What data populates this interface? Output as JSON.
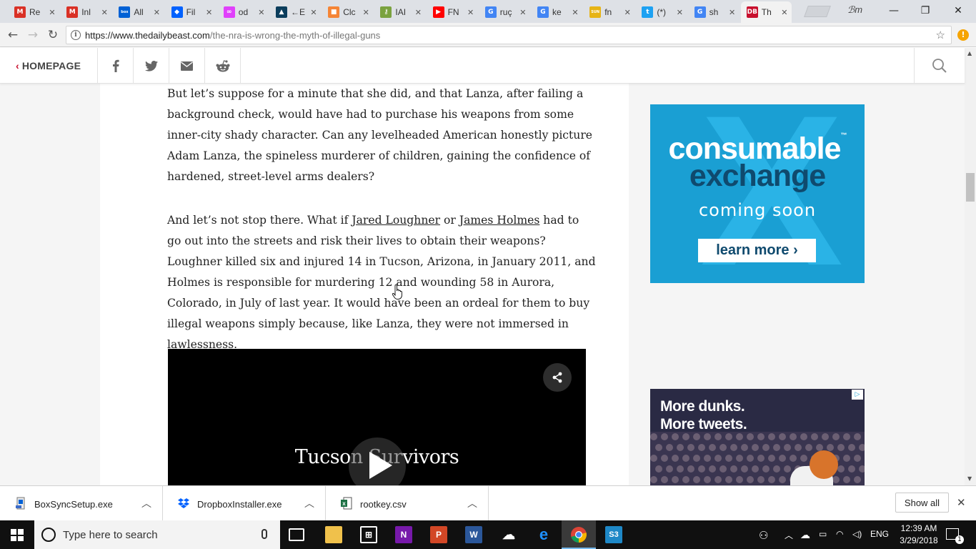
{
  "browser": {
    "tabs": [
      {
        "title": "Re",
        "icon": "gmail-icon",
        "color": "#d93025",
        "glyph": "M"
      },
      {
        "title": "Inl",
        "icon": "gmail-icon",
        "color": "#d93025",
        "glyph": "M"
      },
      {
        "title": "All",
        "icon": "box-icon",
        "color": "#0061d5",
        "glyph": "box"
      },
      {
        "title": "Fil",
        "icon": "dropbox-icon",
        "color": "#0061fe",
        "glyph": "◆"
      },
      {
        "title": "od",
        "icon": "infinity-icon",
        "color": "#e040fb",
        "glyph": "∞"
      },
      {
        "title": "←E",
        "icon": "app-icon",
        "color": "#0b3d5c",
        "glyph": "▲"
      },
      {
        "title": "Clc",
        "icon": "aws-cube-icon",
        "color": "#f58536",
        "glyph": "■"
      },
      {
        "title": "IAI",
        "icon": "key-icon",
        "color": "#7aa23f",
        "glyph": "⚷"
      },
      {
        "title": "FN",
        "icon": "youtube-icon",
        "color": "#ff0000",
        "glyph": "▶"
      },
      {
        "title": "ruç",
        "icon": "google-icon",
        "color": "#4285f4",
        "glyph": "G"
      },
      {
        "title": "ke",
        "icon": "google-icon",
        "color": "#4285f4",
        "glyph": "G"
      },
      {
        "title": "fn",
        "icon": "sun-icon",
        "color": "#e7b416",
        "glyph": "SUN"
      },
      {
        "title": "(*)",
        "icon": "twitter-icon",
        "color": "#1da1f2",
        "glyph": "t"
      },
      {
        "title": "sh",
        "icon": "google-icon",
        "color": "#4285f4",
        "glyph": "G"
      },
      {
        "title": "Th",
        "icon": "daily-beast-icon",
        "color": "#c8102e",
        "glyph": "DB"
      }
    ],
    "profile_label": "ℬm",
    "url_host": "https://www.thedailybeast.com",
    "url_path": "/the-nra-is-wrong-the-myth-of-illegal-guns"
  },
  "site": {
    "home_label": "HOMEPAGE",
    "home_chevron": "‹"
  },
  "article": {
    "para1": "But let’s suppose for a minute that she did, and that Lanza, after failing a background check, would have had to purchase his weapons from some inner-city shady character. Can any levelheaded American honestly picture Adam Lanza, the spineless murderer of children, gaining the confidence of hardened, street-level arms dealers?",
    "para2_a": "And let’s not stop there. What if ",
    "link1": "Jared Loughner",
    "para2_b": " or ",
    "link2": "James Holmes",
    "para2_c": " had to go out into the streets and risk their lives to obtain their weapons? Loughner killed six and injured 14 in Tucson, Arizona, in January 2011, and Holmes is responsible for murdering 12 and wounding 58 in Aurora, Colorado, in July of last year. It would have been an ordeal for them to buy illegal weapons simply because, like Lanza, they were not immersed in lawlessness.",
    "video_title": "Tucson Survivors"
  },
  "ads": {
    "ad1_line1": "consumable",
    "ad1_line1_tm": "™",
    "ad1_line2": "exchange",
    "ad1_line3": "coming soon",
    "ad1_cta": "learn more ›",
    "ad2_line1": "More dunks.",
    "ad2_line2": "More tweets."
  },
  "downloads": [
    {
      "name": "BoxSyncSetup.exe",
      "icon": "box-installer-icon"
    },
    {
      "name": "DropboxInstaller.exe",
      "icon": "dropbox-icon"
    },
    {
      "name": "rootkey.csv",
      "icon": "excel-file-icon"
    }
  ],
  "downloads_show_all": "Show all",
  "taskbar": {
    "search_placeholder": "Type here to search",
    "language": "ENG",
    "time": "12:39 AM",
    "date": "3/29/2018",
    "notifications_count": "1"
  }
}
